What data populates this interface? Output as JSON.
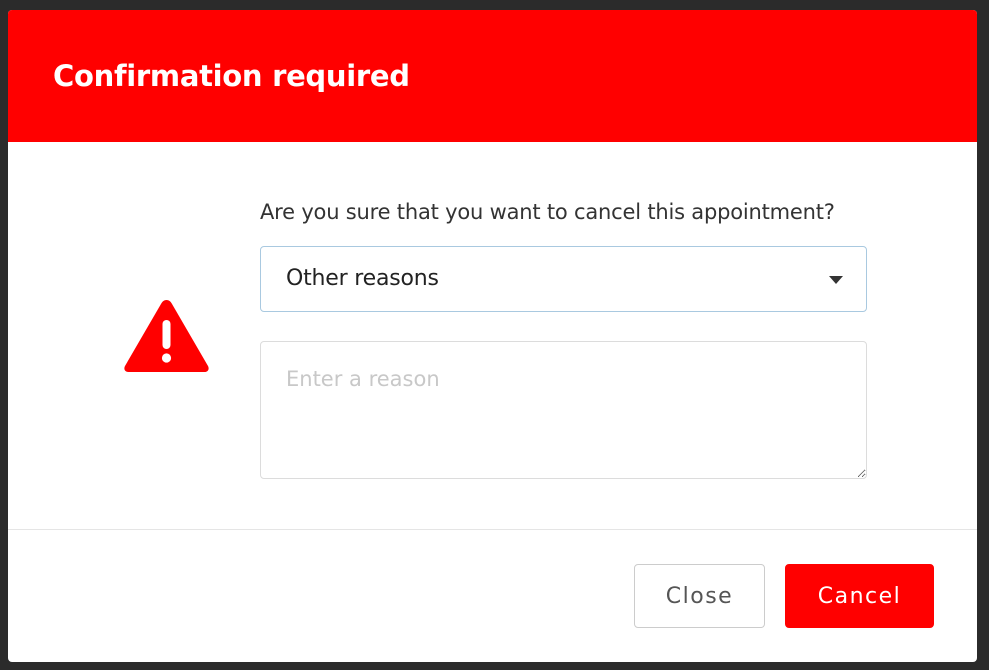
{
  "dialog": {
    "title": "Confirmation required",
    "icon": "warning-icon",
    "question": "Are you sure that you want to cancel this appointment?",
    "reason_select": {
      "selected": "Other reasons"
    },
    "reason_input": {
      "value": "",
      "placeholder": "Enter a reason"
    },
    "buttons": {
      "close_label": "Close",
      "cancel_label": "Cancel"
    }
  },
  "colors": {
    "header": "#ff0000",
    "danger": "#ff0000",
    "select_border": "#a9c9e0",
    "placeholder": "#c8c8c8"
  }
}
